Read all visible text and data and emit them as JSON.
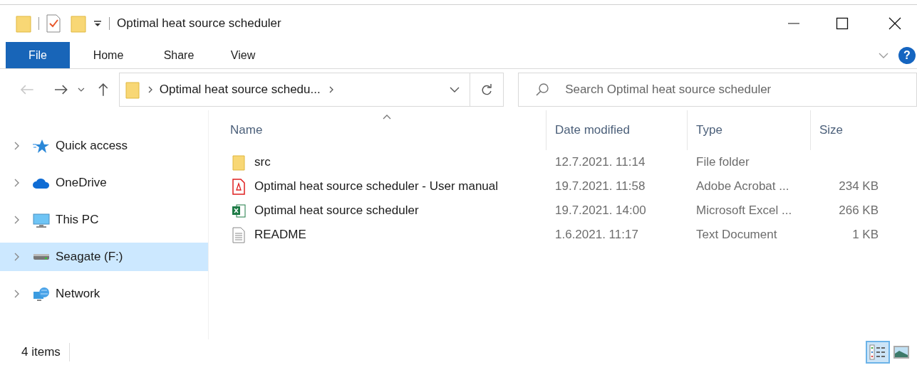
{
  "window": {
    "title": "Optimal heat source scheduler"
  },
  "ribbon_tabs": [
    {
      "label": "File",
      "selected": true
    },
    {
      "label": "Home",
      "selected": false
    },
    {
      "label": "Share",
      "selected": false
    },
    {
      "label": "View",
      "selected": false
    }
  ],
  "help": {
    "label": "?"
  },
  "address_bar": {
    "path": "Optimal heat source schedu..."
  },
  "search": {
    "placeholder": "Search Optimal heat source scheduler"
  },
  "sidebar": {
    "items": [
      {
        "label": "Quick access",
        "kind": "quick",
        "selected": false
      },
      {
        "label": "OneDrive",
        "kind": "cloud",
        "selected": false
      },
      {
        "label": "This PC",
        "kind": "pc",
        "selected": false
      },
      {
        "label": "Seagate (F:)",
        "kind": "drive",
        "selected": true
      },
      {
        "label": "Network",
        "kind": "network",
        "selected": false
      }
    ]
  },
  "table": {
    "columns": [
      "Name",
      "Date modified",
      "Type",
      "Size"
    ],
    "rows": [
      {
        "kind": "folder",
        "name": "src",
        "date": "12.7.2021. 11:14",
        "type": "File folder"
      },
      {
        "kind": "pdf",
        "name": "Optimal heat source scheduler - User manual",
        "date": "19.7.2021. 11:58",
        "type": "Adobe Acrobat ...",
        "size": "234 KB"
      },
      {
        "kind": "excel",
        "name": "Optimal heat source scheduler",
        "date": "19.7.2021. 14:00",
        "type": "Microsoft Excel ...",
        "size": "266 KB"
      },
      {
        "kind": "text",
        "name": "README",
        "date": "1.6.2021. 11:17",
        "type": "Text Document",
        "size": "1 KB"
      }
    ]
  },
  "status_bar": {
    "count": "4 items"
  }
}
